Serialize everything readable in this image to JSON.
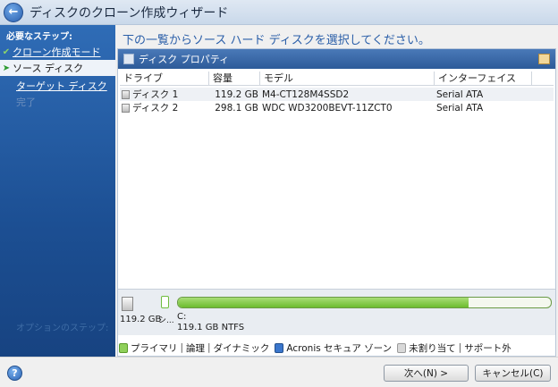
{
  "window": {
    "title": "ディスクのクローン作成ウィザード"
  },
  "steps": {
    "heading": "必要なステップ:",
    "items": [
      {
        "label": "クローン作成モード",
        "state": "done"
      },
      {
        "label": "ソース ディスク",
        "state": "current"
      },
      {
        "label": "ターゲット ディスク",
        "state": "next"
      },
      {
        "label": "完了",
        "state": "pending"
      }
    ],
    "options_link": "オプションのステップ:"
  },
  "instruction": "下の一覧からソース ハード ディスクを選択してください。",
  "panel": {
    "title": "ディスク プロパティ"
  },
  "table": {
    "columns": [
      "ドライブ",
      "容量",
      "モデル",
      "インターフェイス"
    ],
    "rows": [
      {
        "drive": "ディスク 1",
        "capacity": "119.2 GB",
        "model": "M4-CT128M4SSD2",
        "interface": "Serial ATA"
      },
      {
        "drive": "ディスク 2",
        "capacity": "298.1 GB",
        "model": "WDC WD3200BEVT-11ZCT0",
        "interface": "Serial ATA"
      }
    ]
  },
  "disk_map": {
    "disk_size": "119.2 GB",
    "partition_trunc": "シ...",
    "partition_letter": "C:",
    "partition_info": "119.1 GB  NTFS",
    "used_fraction": 0.78
  },
  "legend": {
    "primary": "プライマリ",
    "logical": "論理",
    "dynamic": "ダイナミック",
    "acronis": "Acronis セキュア ゾーン",
    "unallocated": "未割り当て",
    "unsupported": "サポート外"
  },
  "footer": {
    "next_label": "次へ(N) >",
    "cancel_label": "キャンセル(C)"
  },
  "colors": {
    "accent": "#2a5ea8",
    "primary_partition": "#8fd05a",
    "acronis_zone": "#3a76cc"
  }
}
